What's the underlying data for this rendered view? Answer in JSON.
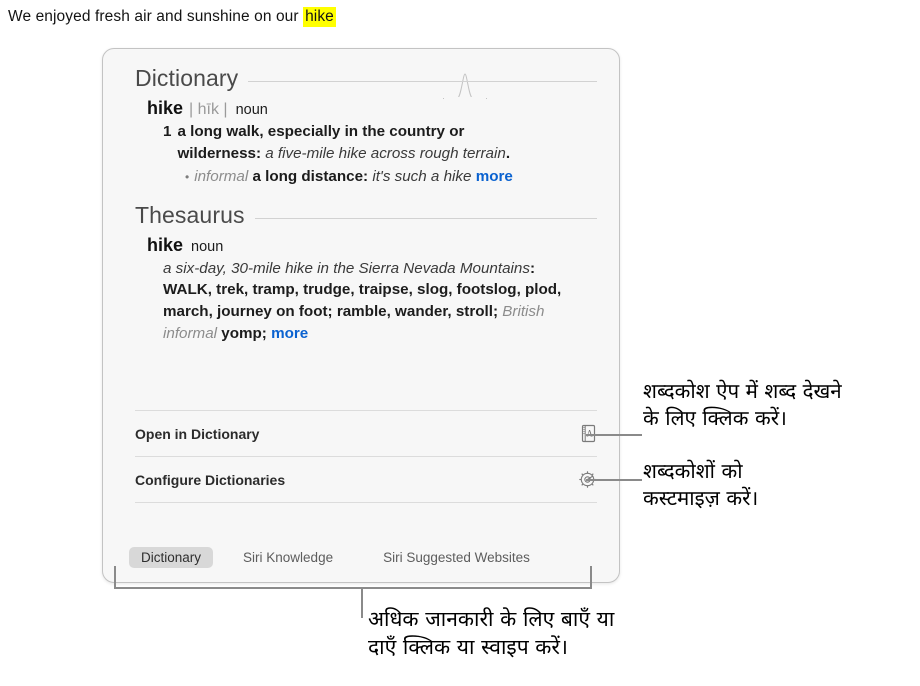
{
  "sentence": {
    "before": "We enjoyed fresh air and sunshine on our ",
    "highlighted": "hike"
  },
  "popover": {
    "dictionary": {
      "section_title": "Dictionary",
      "headword": "hike",
      "pronunciation": "| hīk |",
      "part_of_speech": "noun",
      "senses": [
        {
          "number": "1",
          "definition": "a long walk, especially in the country or wilderness:",
          "example": "a five-mile hike across rough terrain",
          "terminator": "."
        }
      ],
      "subsense": {
        "bullet": "•",
        "register": "informal",
        "definition": "a long distance:",
        "example": "it's such a hike",
        "more_label": "more"
      }
    },
    "thesaurus": {
      "section_title": "Thesaurus",
      "headword": "hike",
      "part_of_speech": "noun",
      "example": "a six-day, 30-mile hike in the Sierra Nevada Mountains",
      "colon": ":",
      "synonyms_primary": "WALK",
      "synonyms_rest": ", trek, tramp, trudge, traipse, slog, footslog, plod, march, journey on foot; ramble, wander, stroll;",
      "register_label": "British informal",
      "register_synonym": "yomp;",
      "more_label": "more"
    },
    "actions": [
      {
        "label": "Open in Dictionary",
        "icon": "book-a-icon"
      },
      {
        "label": "Configure Dictionaries",
        "icon": "gear-icon"
      }
    ],
    "tabs": [
      {
        "label": "Dictionary",
        "active": true
      },
      {
        "label": "Siri Knowledge",
        "active": false
      },
      {
        "label": "Siri Suggested Websites",
        "active": false
      }
    ]
  },
  "annotations": {
    "open_in_dictionary": "शब्दकोश ऐप में शब्द देखने\nके लिए क्लिक करें।",
    "configure_dictionaries": "शब्दकोशों को\nकस्टमाइज़ करें।",
    "tabs_hint": "अधिक जानकारी के लिए बाएँ या\nदाएँ क्लिक या स्वाइप करें।"
  },
  "colors": {
    "highlight": "#ffff00",
    "link": "#0a62d0",
    "popover_bg": "#f7f7f7",
    "leader_line": "#8a8a8a",
    "active_tab_bg": "#d8d8d8"
  }
}
